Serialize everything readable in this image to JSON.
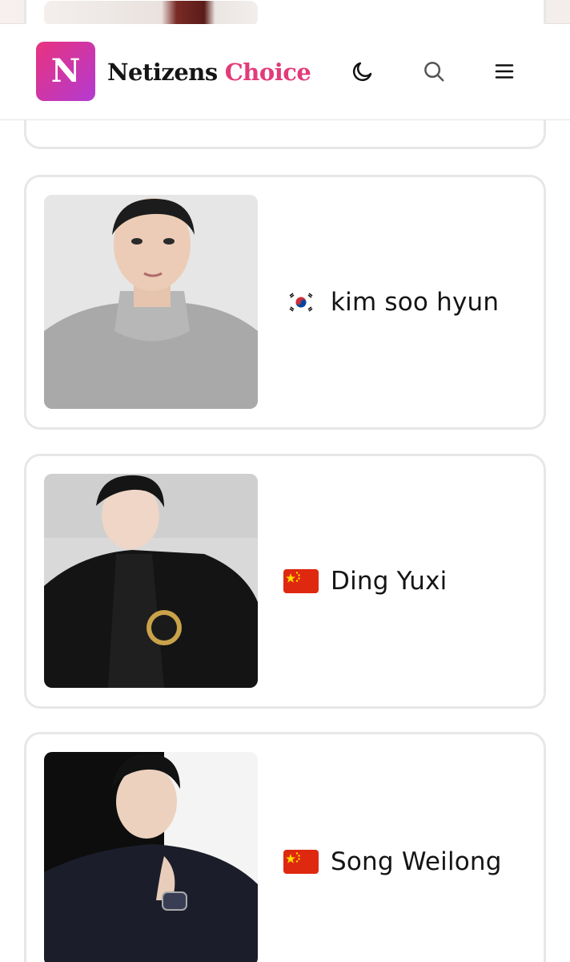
{
  "header": {
    "logo_letter": "N",
    "brand_first": "Netizens",
    "brand_second": "Choice",
    "icons": [
      "moon-icon",
      "search-icon",
      "menu-icon"
    ]
  },
  "colors": {
    "accent": "#e23b7a",
    "logo_gradient_start": "#e8337f",
    "logo_gradient_end": "#b33ad1",
    "card_border": "#e7e7e7"
  },
  "cards": [
    {
      "name": "kim soo hyun",
      "flag": "south-korea-flag-icon"
    },
    {
      "name": "Ding Yuxi",
      "flag": "china-flag-icon"
    },
    {
      "name": "Song Weilong",
      "flag": "china-flag-icon"
    }
  ]
}
